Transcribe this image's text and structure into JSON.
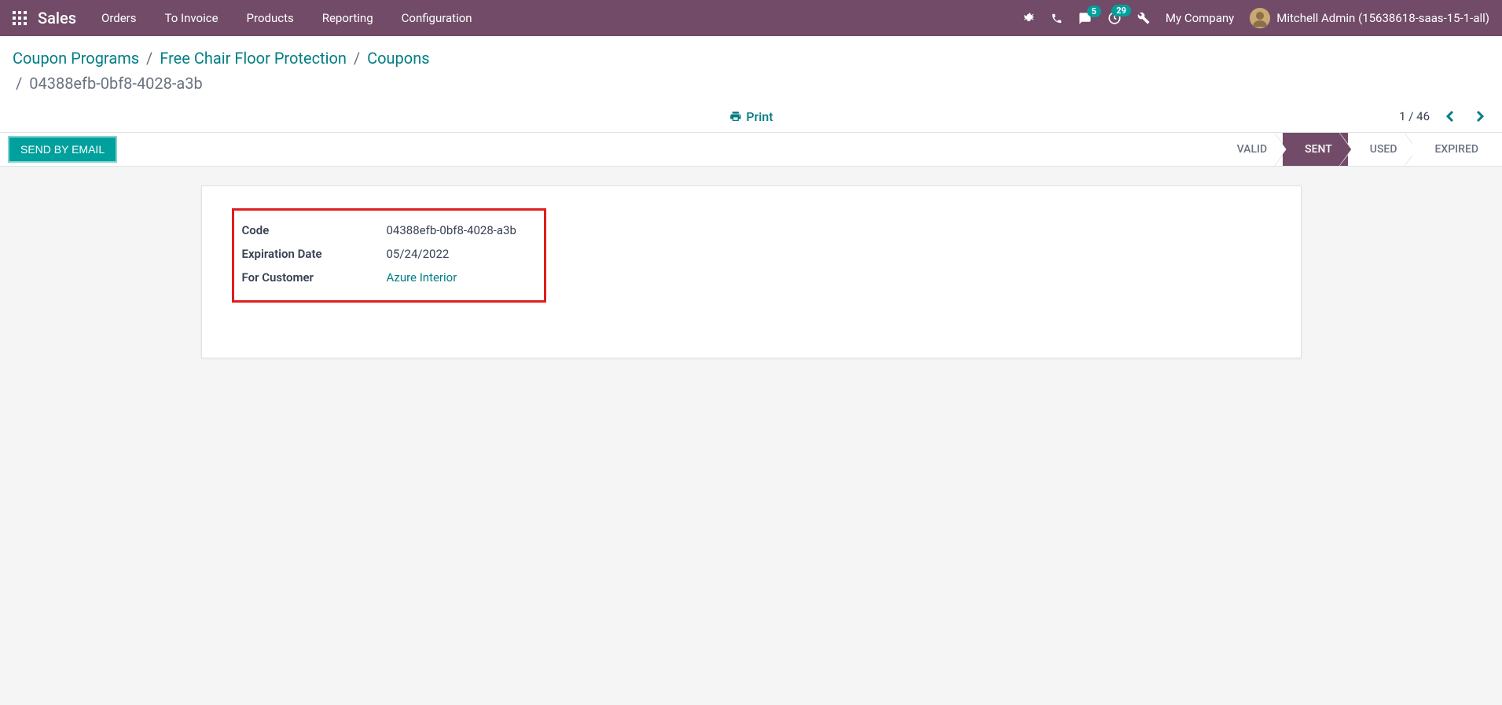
{
  "navbar": {
    "brand": "Sales",
    "menu": [
      "Orders",
      "To Invoice",
      "Products",
      "Reporting",
      "Configuration"
    ],
    "messages_badge": "5",
    "activities_badge": "29",
    "company": "My Company",
    "user": "Mitchell Admin (15638618-saas-15-1-all)"
  },
  "breadcrumb": {
    "items": [
      "Coupon Programs",
      "Free Chair Floor Protection",
      "Coupons"
    ],
    "current": "04388efb-0bf8-4028-a3b"
  },
  "toolbar": {
    "print_label": "Print",
    "pager_text": "1 / 46"
  },
  "statusbar": {
    "send_button": "Send by Email",
    "steps": [
      {
        "label": "Valid",
        "active": false
      },
      {
        "label": "Sent",
        "active": true
      },
      {
        "label": "Used",
        "active": false
      },
      {
        "label": "Expired",
        "active": false
      }
    ]
  },
  "form": {
    "fields": {
      "code": {
        "label": "Code",
        "value": "04388efb-0bf8-4028-a3b"
      },
      "expiration": {
        "label": "Expiration Date",
        "value": "05/24/2022"
      },
      "customer": {
        "label": "For Customer",
        "value": "Azure Interior"
      }
    }
  }
}
